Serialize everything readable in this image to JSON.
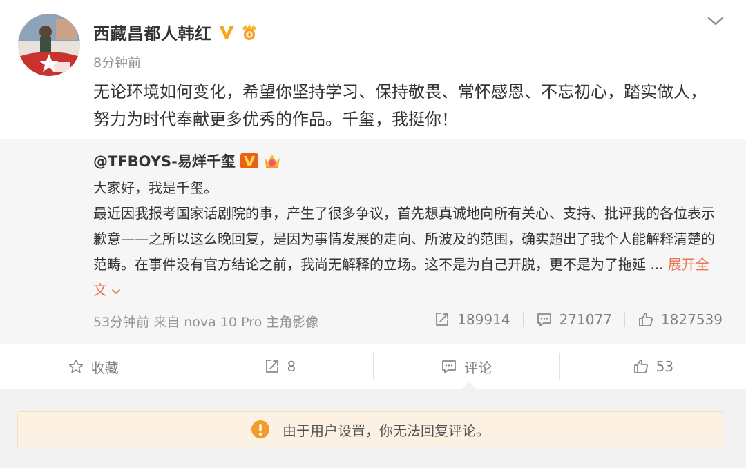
{
  "post": {
    "author": "西藏昌都人韩红",
    "time": "8分钟前",
    "text": "无论环境如何变化，希望你坚持学习、保持敬畏、常怀感恩、不忘初心，踏实做人，努力为时代奉献更多优秀的作品。千玺，我挺你！"
  },
  "repost": {
    "author": "@TFBOYS-易烊千玺",
    "text_line1": "大家好，我是千玺。",
    "text_body": "最近因我报考国家话剧院的事，产生了很多争议，首先想真诚地向所有关心、支持、批评我的各位表示歉意——之所以这么晚回复，是因为事情发展的走向、所波及的范围，确实超出了我个人能解释清楚的范畴。在事件没有官方结论之前，我尚无解释的立场。这不是为自己开脱，更不是为了拖延 ...",
    "expand_label": "展开全文",
    "meta": "53分钟前 来自 nova 10 Pro 主角影像",
    "reposts": "189914",
    "comments": "271077",
    "likes": "1827539"
  },
  "actions": {
    "favorite_label": "收藏",
    "repost_count": "8",
    "comment_label": "评论",
    "like_count": "53"
  },
  "notice": {
    "text": "由于用户设置，你无法回复评论。"
  },
  "colors": {
    "accent": "#eb7350",
    "verified": "#f6a623",
    "notice_icon": "#f39c2c",
    "notice_bg": "#fdf1e3"
  },
  "icons": [
    "chevron-down-icon",
    "verified-v-icon",
    "medal-icon",
    "crown-icon",
    "repost-icon",
    "comment-icon",
    "like-icon",
    "star-icon",
    "warning-icon"
  ]
}
